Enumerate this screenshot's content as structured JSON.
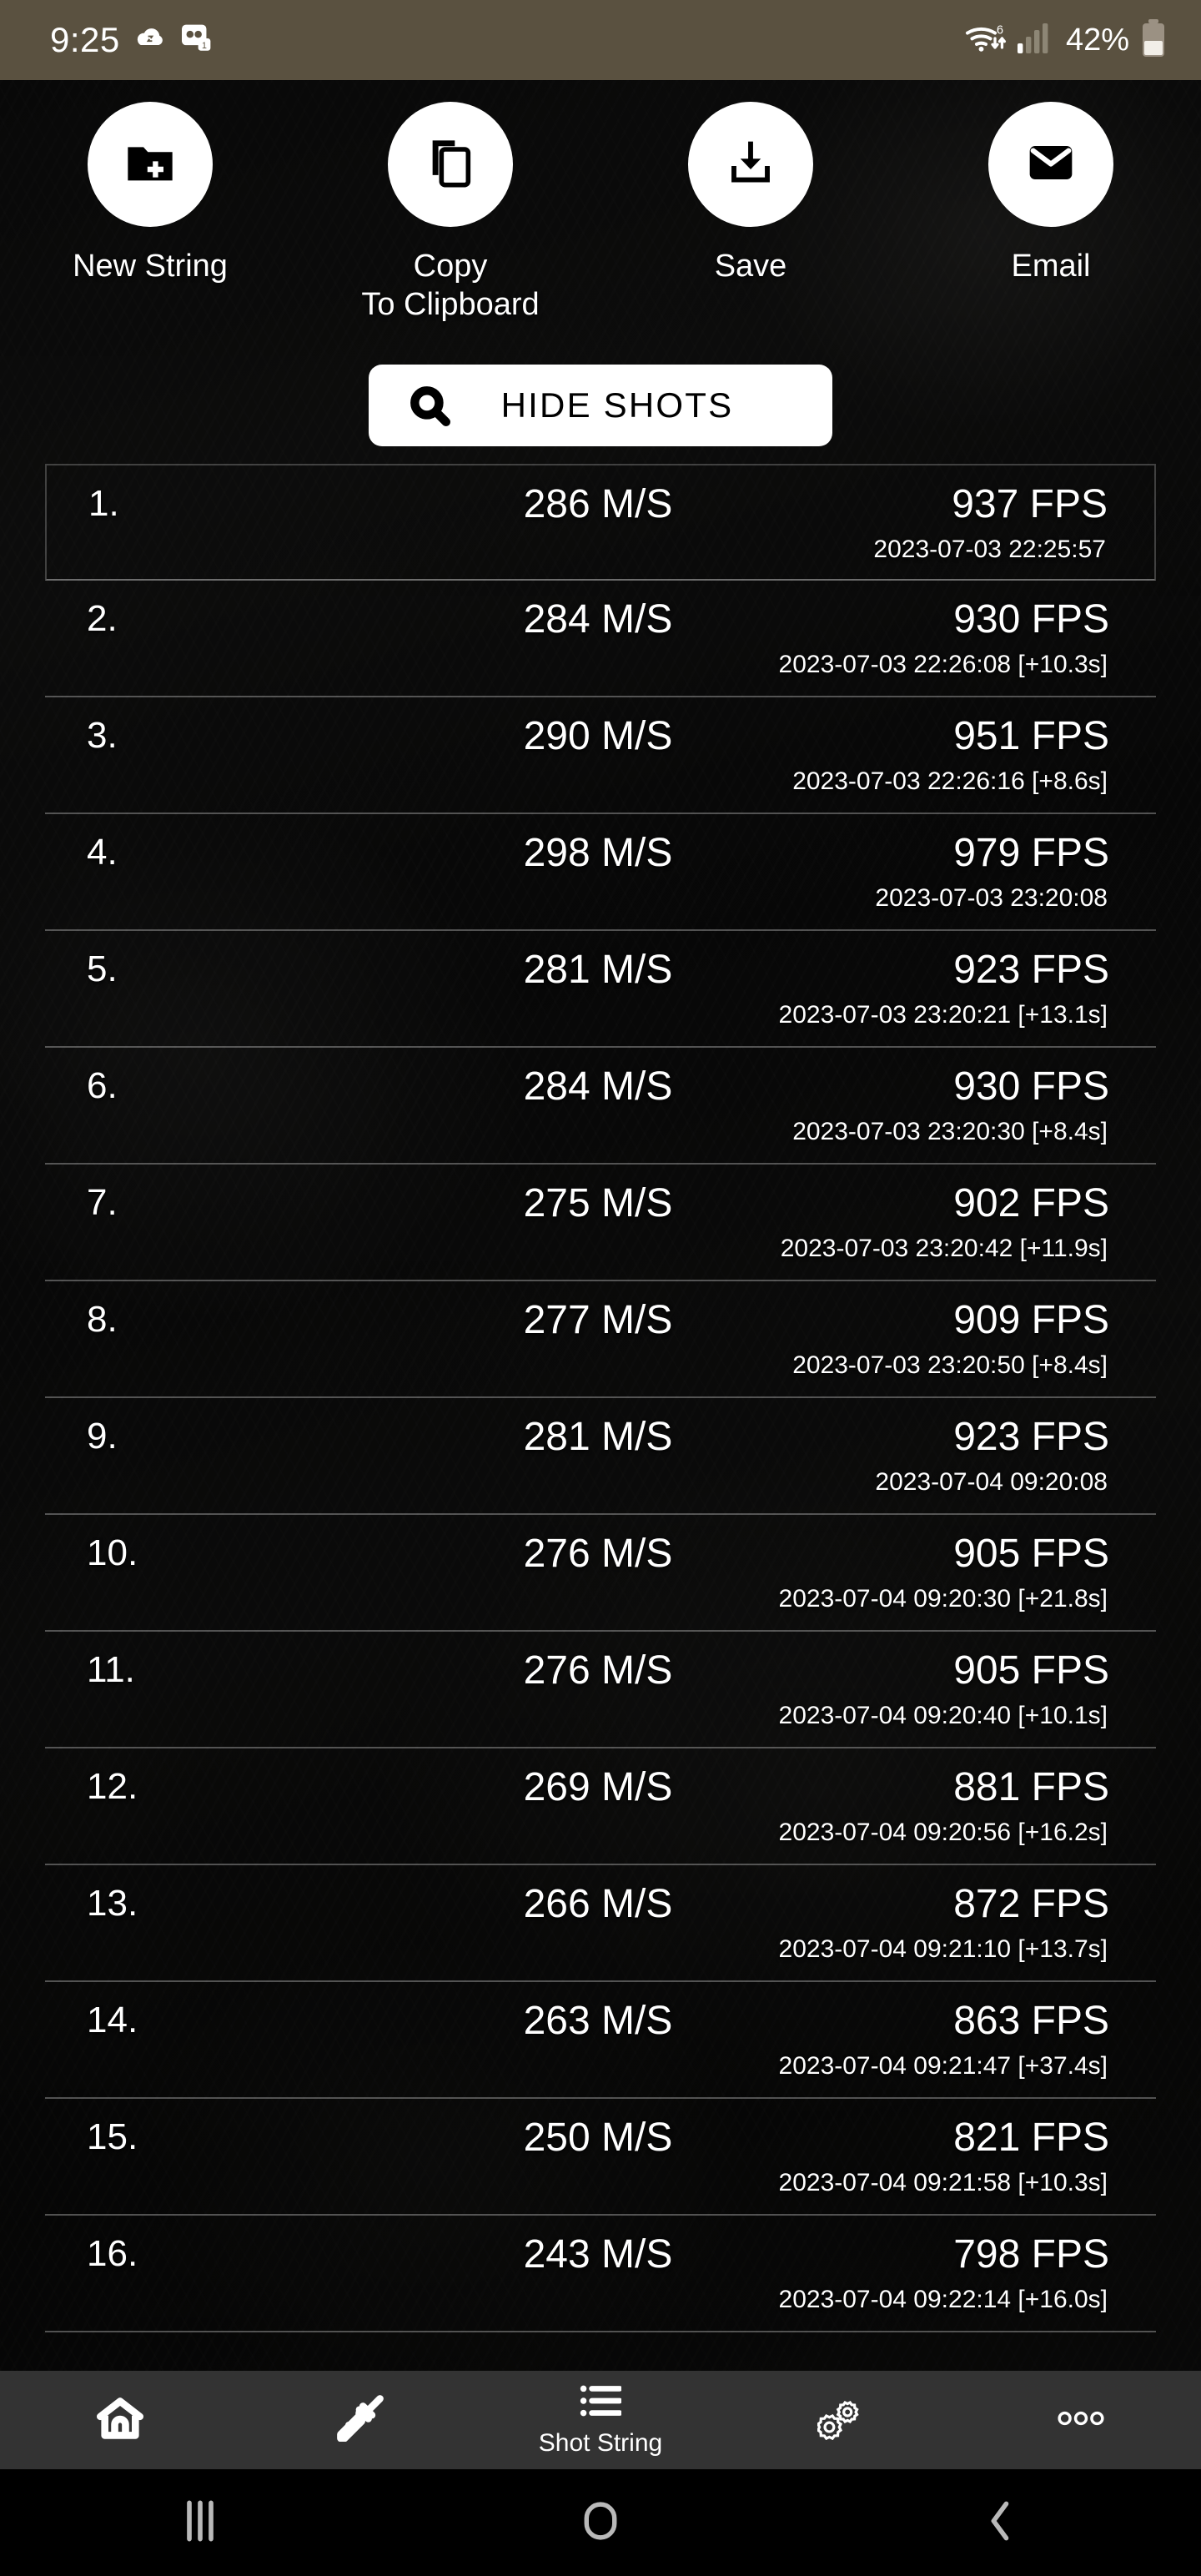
{
  "statusbar": {
    "time": "9:25",
    "battery_percent": "42%",
    "icons": [
      "cloud-sync-icon",
      "voicemail-icon",
      "wifi-6-icon",
      "cellular-signal-icon",
      "battery-icon"
    ]
  },
  "actions": [
    {
      "label": "New String",
      "icon": "folder-plus-icon"
    },
    {
      "label": "Copy\nTo Clipboard",
      "label_line1": "Copy",
      "label_line2": "To Clipboard",
      "icon": "copy-icon"
    },
    {
      "label": "Save",
      "icon": "download-icon"
    },
    {
      "label": "Email",
      "icon": "envelope-icon"
    }
  ],
  "hide_shots": {
    "label": "HIDE SHOTS",
    "icon": "search-icon"
  },
  "shots": [
    {
      "index": "1.",
      "speed": "286 M/S",
      "fps": "937 FPS",
      "timestamp": "2023-07-03 22:25:57",
      "selected": true
    },
    {
      "index": "2.",
      "speed": "284 M/S",
      "fps": "930 FPS",
      "timestamp": "2023-07-03 22:26:08 [+10.3s]",
      "selected": false
    },
    {
      "index": "3.",
      "speed": "290 M/S",
      "fps": "951 FPS",
      "timestamp": "2023-07-03 22:26:16 [+8.6s]",
      "selected": false
    },
    {
      "index": "4.",
      "speed": "298 M/S",
      "fps": "979 FPS",
      "timestamp": "2023-07-03 23:20:08",
      "selected": false
    },
    {
      "index": "5.",
      "speed": "281 M/S",
      "fps": "923 FPS",
      "timestamp": "2023-07-03 23:20:21 [+13.1s]",
      "selected": false
    },
    {
      "index": "6.",
      "speed": "284 M/S",
      "fps": "930 FPS",
      "timestamp": "2023-07-03 23:20:30 [+8.4s]",
      "selected": false
    },
    {
      "index": "7.",
      "speed": "275 M/S",
      "fps": "902 FPS",
      "timestamp": "2023-07-03 23:20:42 [+11.9s]",
      "selected": false
    },
    {
      "index": "8.",
      "speed": "277 M/S",
      "fps": "909 FPS",
      "timestamp": "2023-07-03 23:20:50 [+8.4s]",
      "selected": false
    },
    {
      "index": "9.",
      "speed": "281 M/S",
      "fps": "923 FPS",
      "timestamp": "2023-07-04 09:20:08",
      "selected": false
    },
    {
      "index": "10.",
      "speed": "276 M/S",
      "fps": "905 FPS",
      "timestamp": "2023-07-04 09:20:30 [+21.8s]",
      "selected": false
    },
    {
      "index": "11.",
      "speed": "276 M/S",
      "fps": "905 FPS",
      "timestamp": "2023-07-04 09:20:40 [+10.1s]",
      "selected": false
    },
    {
      "index": "12.",
      "speed": "269 M/S",
      "fps": "881 FPS",
      "timestamp": "2023-07-04 09:20:56 [+16.2s]",
      "selected": false
    },
    {
      "index": "13.",
      "speed": "266 M/S",
      "fps": "872 FPS",
      "timestamp": "2023-07-04 09:21:10 [+13.7s]",
      "selected": false
    },
    {
      "index": "14.",
      "speed": "263 M/S",
      "fps": "863 FPS",
      "timestamp": "2023-07-04 09:21:47 [+37.4s]",
      "selected": false
    },
    {
      "index": "15.",
      "speed": "250 M/S",
      "fps": "821 FPS",
      "timestamp": "2023-07-04 09:21:58 [+10.3s]",
      "selected": false
    },
    {
      "index": "16.",
      "speed": "243 M/S",
      "fps": "798 FPS",
      "timestamp": "2023-07-04 09:22:14 [+16.0s]",
      "selected": false
    }
  ],
  "bottom_nav": [
    {
      "label": "",
      "icon": "home-icon",
      "active": false
    },
    {
      "label": "",
      "icon": "rifle-icon",
      "active": false
    },
    {
      "label": "Shot String",
      "icon": "list-icon",
      "active": true
    },
    {
      "label": "",
      "icon": "gears-icon",
      "active": false
    },
    {
      "label": "",
      "icon": "more-dots-icon",
      "active": false
    }
  ],
  "system_nav": [
    {
      "icon": "recents-icon"
    },
    {
      "icon": "home-circle-icon"
    },
    {
      "icon": "back-icon"
    }
  ],
  "colors": {
    "statusbar_bg": "#5a5140",
    "bottomnav_bg": "#333333",
    "accent_white": "#ffffff",
    "sysnav_bg": "#000000"
  }
}
